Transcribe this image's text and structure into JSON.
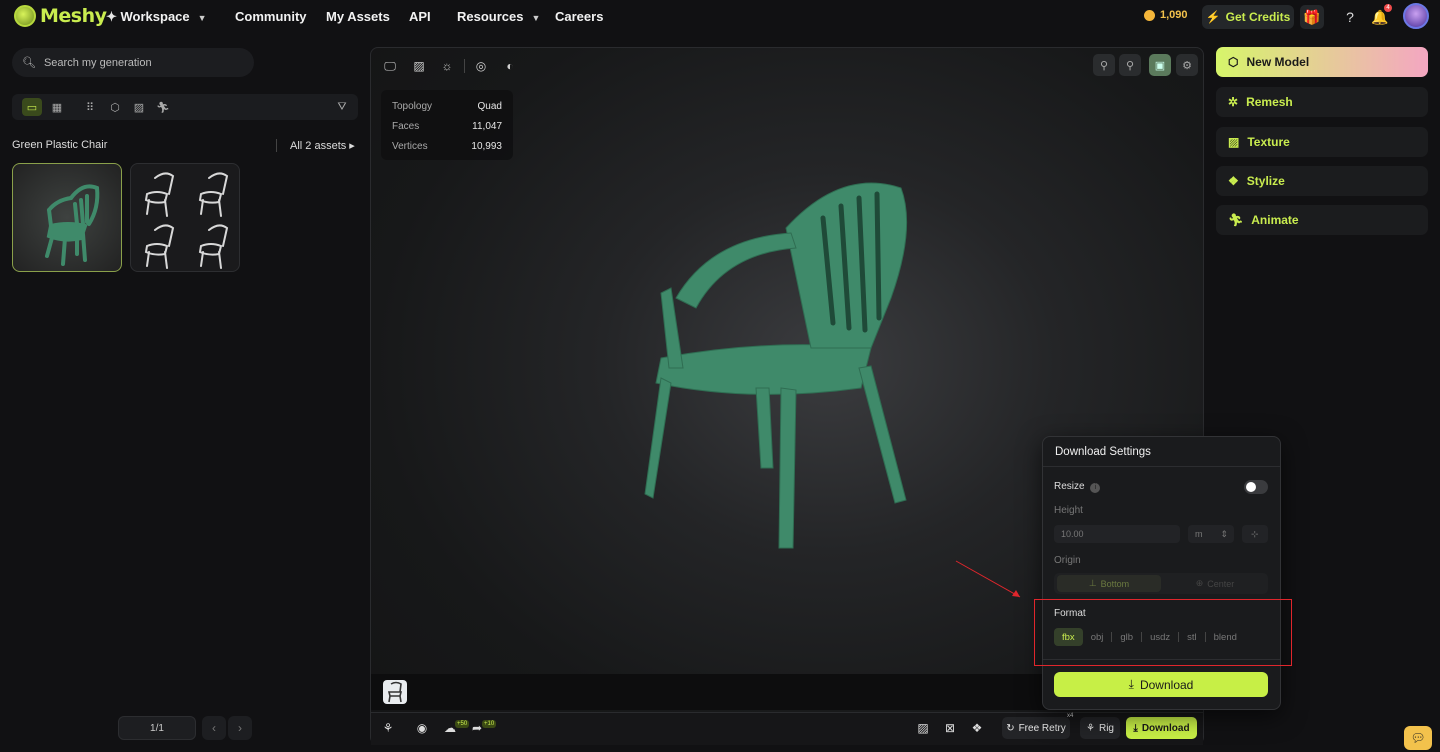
{
  "header": {
    "logo_text": "Meshy",
    "nav": [
      {
        "label": "Workspace",
        "has_caret": true,
        "icon": "sparkle-icon"
      },
      {
        "label": "Community"
      },
      {
        "label": "My Assets"
      },
      {
        "label": "API"
      },
      {
        "label": "Resources",
        "has_caret": true
      },
      {
        "label": "Careers"
      }
    ],
    "credits": "1,090",
    "get_credits": "Get Credits",
    "notification_count": "4"
  },
  "sidebar": {
    "search_placeholder": "Search my generation",
    "section_title": "Green Plastic Chair",
    "all_assets": "All 2 assets",
    "pager": "1/1"
  },
  "viewer": {
    "stats": [
      {
        "label": "Topology",
        "value": "Quad"
      },
      {
        "label": "Faces",
        "value": "11,047"
      },
      {
        "label": "Vertices",
        "value": "10,993"
      }
    ],
    "bottom": {
      "badge_upload": "+50",
      "badge_share": "+10",
      "retry_label": "Free Retry",
      "retry_count": "x4",
      "rig_label": "Rig",
      "download_label": "Download"
    },
    "model_color": "#3f8a6a"
  },
  "actions": [
    {
      "label": "New Model",
      "icon": "cube-icon"
    },
    {
      "label": "Remesh",
      "icon": "remesh-icon"
    },
    {
      "label": "Texture",
      "icon": "texture-icon"
    },
    {
      "label": "Stylize",
      "icon": "stylize-icon"
    },
    {
      "label": "Animate",
      "icon": "running-person-icon"
    }
  ],
  "download_settings": {
    "title": "Download Settings",
    "resize_label": "Resize",
    "height_label": "Height",
    "height_value": "10.00",
    "unit": "m",
    "origin_label": "Origin",
    "origin_options": [
      "Bottom",
      "Center"
    ],
    "format_label": "Format",
    "formats": [
      "fbx",
      "obj",
      "glb",
      "usdz",
      "stl",
      "blend"
    ],
    "selected_format": "fbx",
    "download_button": "Download"
  },
  "colors": {
    "accent": "#c7ef46",
    "highlight_box": "#e0262c"
  }
}
